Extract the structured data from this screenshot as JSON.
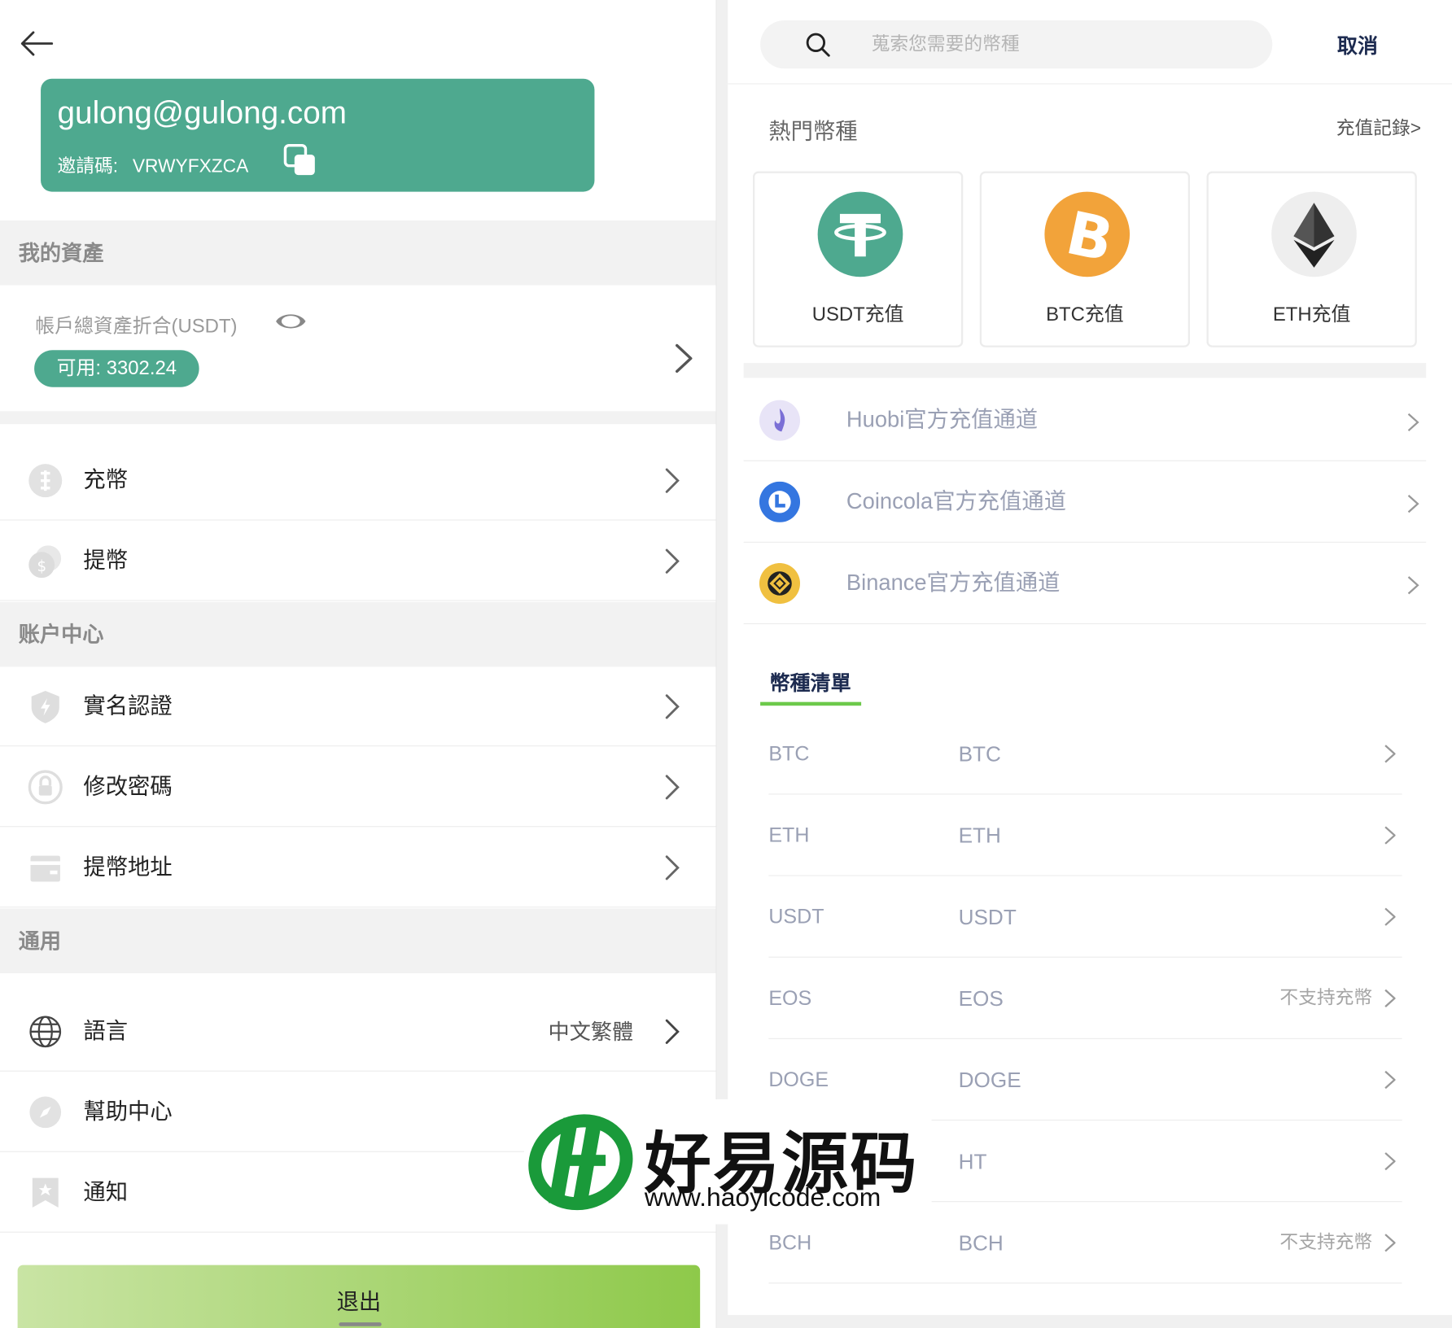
{
  "left": {
    "user": {
      "email": "gulong@gulong.com",
      "invite_label": "邀請碼:",
      "invite_code": "VRWYFXZCA"
    },
    "sections": {
      "assets": "我的資產",
      "account": "账户中心",
      "general": "通用"
    },
    "assets": {
      "label": "帳戶總資產折合(USDT)",
      "available": "可用: 3302.24"
    },
    "menu": {
      "deposit": "充幣",
      "withdraw": "提幣",
      "kyc": "實名認證",
      "password": "修改密碼",
      "address": "提幣地址",
      "language": "語言",
      "language_value": "中文繁體",
      "help": "幫助中心",
      "notice": "通知"
    },
    "logout": "退出"
  },
  "right": {
    "search": {
      "placeholder": "蒐索您需要的幣種",
      "cancel": "取消"
    },
    "hot_title": "熱門幣種",
    "records": "充值記錄>",
    "hot_coins": [
      {
        "label": "USDT充值",
        "color": "#4ea98f"
      },
      {
        "label": "BTC充值",
        "color": "#f2a33a"
      },
      {
        "label": "ETH充值",
        "color": "#eeeeee"
      }
    ],
    "channels": [
      {
        "label": "Huobi官方充值通道"
      },
      {
        "label": "Coincola官方充值通道"
      },
      {
        "label": "Binance官方充值通道"
      }
    ],
    "list_title": "幣種清單",
    "coins": [
      {
        "code": "BTC",
        "name": "BTC",
        "note": ""
      },
      {
        "code": "ETH",
        "name": "ETH",
        "note": ""
      },
      {
        "code": "USDT",
        "name": "USDT",
        "note": ""
      },
      {
        "code": "EOS",
        "name": "EOS",
        "note": "不支持充幣"
      },
      {
        "code": "DOGE",
        "name": "DOGE",
        "note": ""
      },
      {
        "code": "",
        "name": "HT",
        "note": ""
      },
      {
        "code": "BCH",
        "name": "BCH",
        "note": "不支持充幣"
      }
    ]
  },
  "watermark": {
    "title": "好易源码",
    "url": "www.haoyicode.com"
  },
  "colors": {
    "accent": "#4ea98f",
    "navy": "#1d2b50",
    "green": "#6cc94a"
  }
}
